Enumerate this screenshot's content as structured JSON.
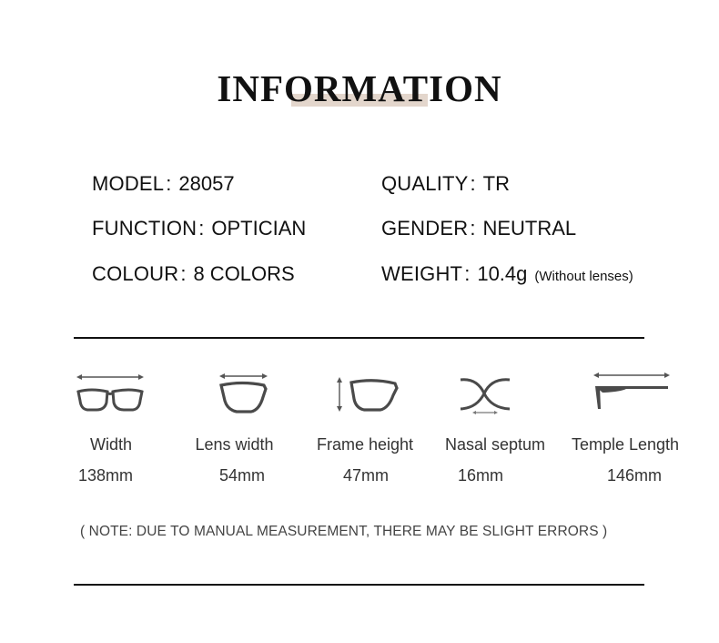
{
  "title": "INFORMATION",
  "accent_color": "#e3d6cc",
  "specs": {
    "model": {
      "label": "MODEL",
      "sep": ":",
      "value": "28057"
    },
    "function": {
      "label": "FUNCTION",
      "sep": ":",
      "value": "OPTICIAN"
    },
    "colour": {
      "label": "COLOUR",
      "sep": ":",
      "value": "8 COLORS"
    },
    "quality": {
      "label": "QUALITY",
      "sep": ":",
      "value": "TR"
    },
    "gender": {
      "label": "GENDER",
      "sep": ":",
      "value": "NEUTRAL"
    },
    "weight": {
      "label": "WEIGHT",
      "sep": ":",
      "value": "10.4g",
      "note": "(Without lenses)"
    }
  },
  "measurements": [
    {
      "icon": "glasses-width-icon",
      "label": "Width",
      "value": "138mm"
    },
    {
      "icon": "lens-width-icon",
      "label": "Lens width",
      "value": "54mm"
    },
    {
      "icon": "frame-height-icon",
      "label": "Frame height",
      "value": "47mm"
    },
    {
      "icon": "nasal-septum-icon",
      "label": "Nasal septum",
      "value": "16mm"
    },
    {
      "icon": "temple-length-icon",
      "label": "Temple Length",
      "value": "146mm"
    }
  ],
  "footnote": "( NOTE: DUE TO MANUAL MEASUREMENT, THERE MAY BE SLIGHT ERRORS )"
}
